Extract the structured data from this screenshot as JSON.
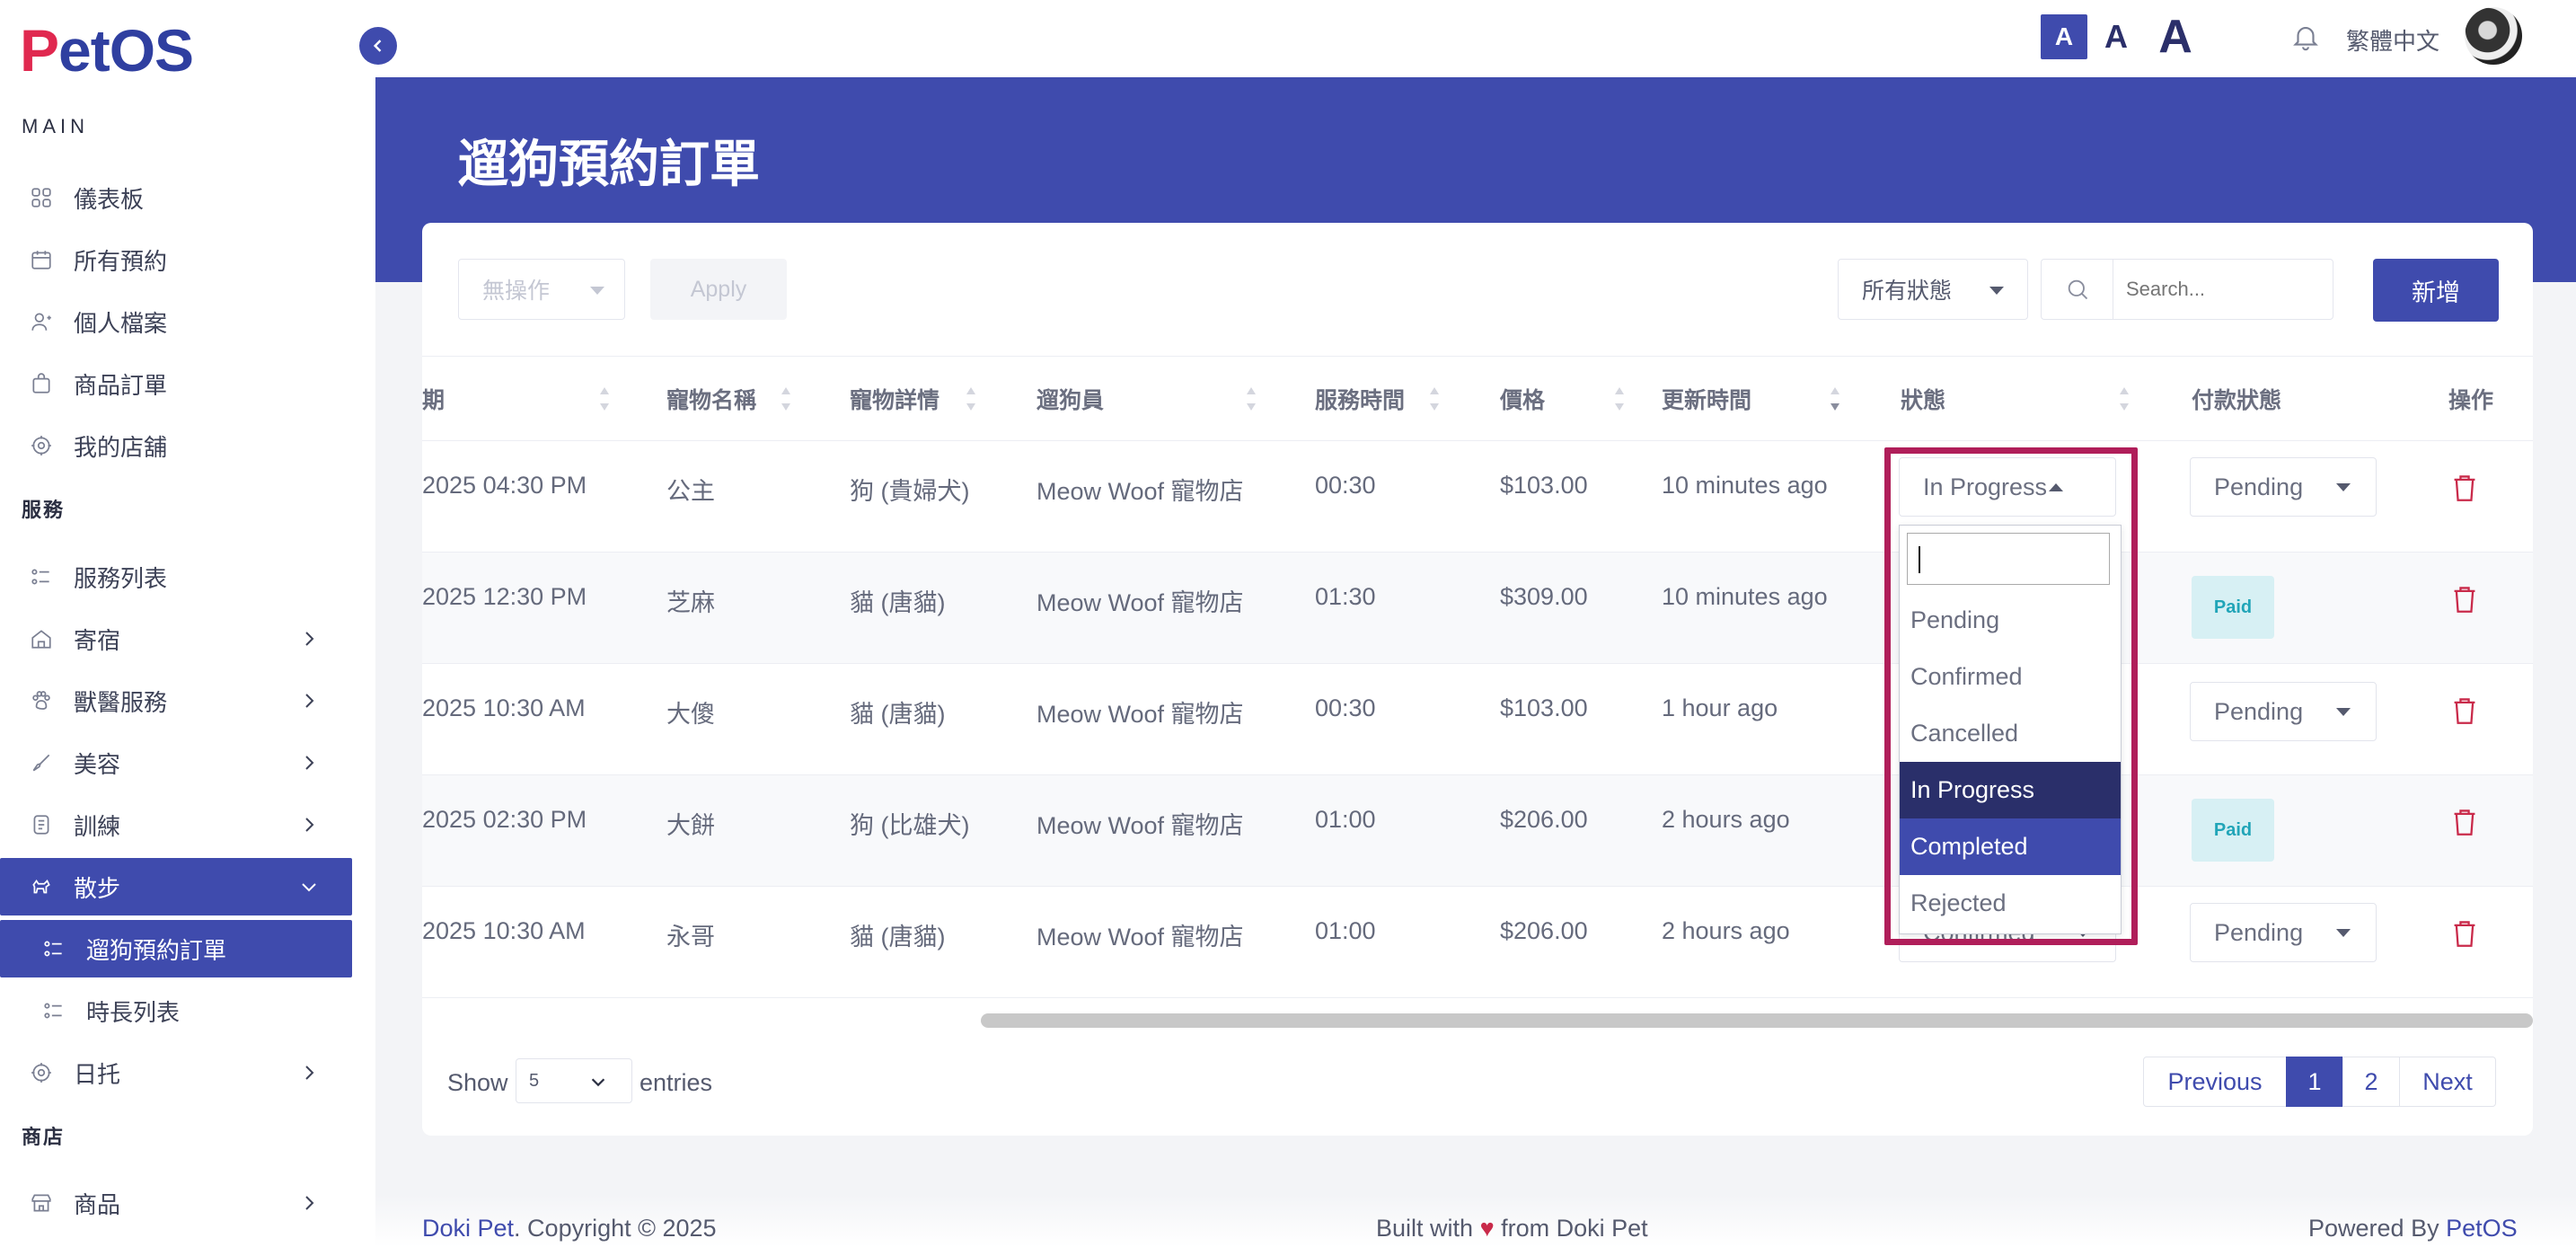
{
  "brand": {
    "logo_p": "P",
    "logo_rest": "etOS"
  },
  "sidebar": {
    "sections": {
      "main": "MAIN",
      "services": "服務",
      "shop": "商店"
    },
    "items": [
      {
        "label": "儀表板",
        "icon": "dashboard-icon"
      },
      {
        "label": "所有預約",
        "icon": "calendar-icon"
      },
      {
        "label": "個人檔案",
        "icon": "user-icon"
      },
      {
        "label": "商品訂單",
        "icon": "bag-icon"
      },
      {
        "label": "我的店舖",
        "icon": "store-icon"
      },
      {
        "label": "服務列表",
        "icon": "list-icon"
      },
      {
        "label": "寄宿",
        "icon": "home-icon"
      },
      {
        "label": "獸醫服務",
        "icon": "paw-icon"
      },
      {
        "label": "美容",
        "icon": "brush-icon"
      },
      {
        "label": "訓練",
        "icon": "training-icon"
      },
      {
        "label": "散步",
        "icon": "dog-walk-icon"
      },
      {
        "label": "遛狗預約訂單",
        "icon": "list-icon"
      },
      {
        "label": "時長列表",
        "icon": "list-icon"
      },
      {
        "label": "日托",
        "icon": "paw-icon"
      },
      {
        "label": "商品",
        "icon": "shop-icon"
      }
    ]
  },
  "topbar": {
    "font_sm": "A",
    "font_md": "A",
    "font_lg": "A",
    "language": "繁體中文"
  },
  "page": {
    "title": "遛狗預約訂單"
  },
  "toolbar": {
    "bulk_action": "無操作",
    "apply": "Apply",
    "status_filter": "所有狀態",
    "search_placeholder": "Search...",
    "add": "新增"
  },
  "table": {
    "headers": [
      "期",
      "寵物名稱",
      "寵物詳情",
      "遛狗員",
      "服務時間",
      "價格",
      "更新時間",
      "狀態",
      "付款狀態",
      "操作"
    ],
    "rows": [
      {
        "date": "2025 04:30 PM",
        "pet": "公主",
        "detail": "狗 (貴婦犬)",
        "walker": "Meow Woof 寵物店",
        "duration": "00:30",
        "price": "$103.00",
        "updated": "10 minutes ago",
        "status": "In Progress",
        "payment": "Pending"
      },
      {
        "date": "2025 12:30 PM",
        "pet": "芝麻",
        "detail": "貓 (唐貓)",
        "walker": "Meow Woof 寵物店",
        "duration": "01:30",
        "price": "$309.00",
        "updated": "10 minutes ago",
        "status": "",
        "payment": "Paid"
      },
      {
        "date": "2025 10:30 AM",
        "pet": "大傻",
        "detail": "貓 (唐貓)",
        "walker": "Meow Woof 寵物店",
        "duration": "00:30",
        "price": "$103.00",
        "updated": "1 hour ago",
        "status": "",
        "payment": "Pending"
      },
      {
        "date": "2025 02:30 PM",
        "pet": "大餅",
        "detail": "狗 (比雄犬)",
        "walker": "Meow Woof 寵物店",
        "duration": "01:00",
        "price": "$206.00",
        "updated": "2 hours ago",
        "status": "",
        "payment": "Paid"
      },
      {
        "date": "2025 10:30 AM",
        "pet": "永哥",
        "detail": "貓 (唐貓)",
        "walker": "Meow Woof 寵物店",
        "duration": "01:00",
        "price": "$206.00",
        "updated": "2 hours ago",
        "status": "Confirmed",
        "payment": "Pending"
      }
    ]
  },
  "dropdown": {
    "options": [
      "Pending",
      "Confirmed",
      "Cancelled",
      "In Progress",
      "Completed",
      "Rejected"
    ],
    "selected": "In Progress",
    "hovered": "Completed"
  },
  "pagination": {
    "show": "Show",
    "entries_value": "5",
    "entries": "entries",
    "previous": "Previous",
    "pages": [
      "1",
      "2"
    ],
    "next": "Next",
    "current": "1"
  },
  "footer": {
    "brand": "Doki Pet",
    "copyright": ". Copyright © 2025",
    "built_pre": "Built with",
    "heart": "♥",
    "built_post": "from Doki Pet",
    "powered_pre": "Powered By",
    "powered_brand": "PetOS"
  },
  "colors": {
    "primary": "#3f4bad",
    "brand_red": "#e0284f",
    "highlight": "#b01e5a",
    "danger": "#c92a4a",
    "paid_bg": "#d7f0f4"
  }
}
